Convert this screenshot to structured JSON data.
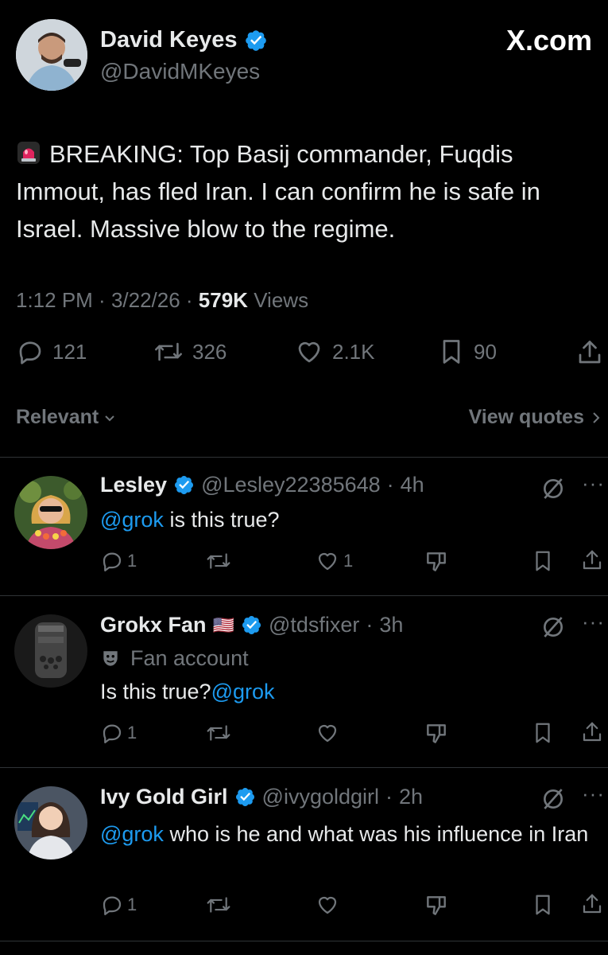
{
  "main_tweet": {
    "author_name": "David Keyes",
    "author_handle": "@DavidMKeyes",
    "site_watermark": "X.com",
    "text": "BREAKING: Top Basij commander, Fuqdis Immout, has fled Iran. I can confirm he is safe in Israel. Massive blow to the regime.",
    "time": "1:12 PM",
    "date": "3/22/26",
    "views_count": "579K",
    "views_label": "Views",
    "replies": "121",
    "reposts": "326",
    "likes": "2.1K",
    "bookmarks": "90"
  },
  "sort": {
    "label": "Relevant",
    "view_quotes": "View quotes"
  },
  "replies": [
    {
      "name": "Lesley",
      "handle": "@Lesley22385648",
      "time": "4h",
      "mention": "@grok",
      "text": " is this true?",
      "replies": "1",
      "likes": "1"
    },
    {
      "name": "Grokx Fan",
      "flag": "🇺🇸",
      "handle": "@tdsfixer",
      "time": "3h",
      "label": "Fan account",
      "text": "Is this true?",
      "mention": "@grok",
      "replies": "1",
      "likes": ""
    },
    {
      "name": "Ivy Gold Girl",
      "handle": "@ivygoldgirl",
      "time": "2h",
      "mention": "@grok",
      "text": " who is he and what was his influence in Iran",
      "replies": "1",
      "likes": ""
    }
  ],
  "colors": {
    "accent": "#1d9bf0",
    "muted": "#71767b",
    "text": "#e7e9ea",
    "background": "#000000",
    "siren": "#e0245e"
  }
}
